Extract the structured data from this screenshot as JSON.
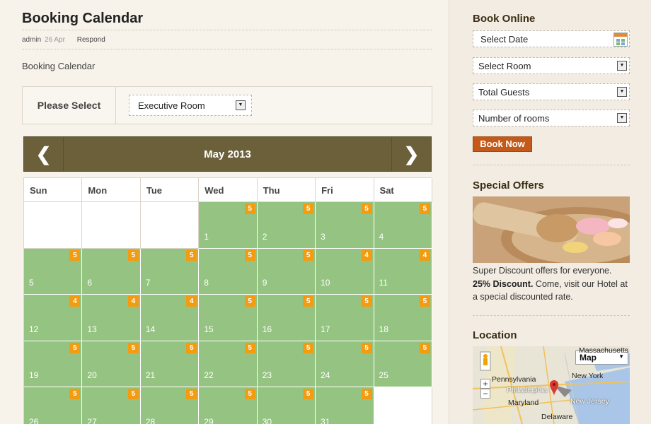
{
  "post": {
    "title": "Booking Calendar",
    "author": "admin",
    "date": "26 Apr",
    "respond": "Respond",
    "subtitle": "Booking Calendar"
  },
  "selector": {
    "label": "Please Select",
    "room_value": "Executive Room"
  },
  "calendar": {
    "prev_label": "❮",
    "next_label": "❯",
    "month": "May 2013",
    "weekdays": [
      "Sun",
      "Mon",
      "Tue",
      "Wed",
      "Thu",
      "Fri",
      "Sat"
    ],
    "leading_empty": 3,
    "days": [
      {
        "day": "1",
        "avail": "5"
      },
      {
        "day": "2",
        "avail": "5"
      },
      {
        "day": "3",
        "avail": "5"
      },
      {
        "day": "4",
        "avail": "5"
      },
      {
        "day": "5",
        "avail": "5"
      },
      {
        "day": "6",
        "avail": "5"
      },
      {
        "day": "7",
        "avail": "5"
      },
      {
        "day": "8",
        "avail": "5"
      },
      {
        "day": "9",
        "avail": "5"
      },
      {
        "day": "10",
        "avail": "4"
      },
      {
        "day": "11",
        "avail": "4"
      },
      {
        "day": "12",
        "avail": "4"
      },
      {
        "day": "13",
        "avail": "4"
      },
      {
        "day": "14",
        "avail": "4"
      },
      {
        "day": "15",
        "avail": "5"
      },
      {
        "day": "16",
        "avail": "5"
      },
      {
        "day": "17",
        "avail": "5"
      },
      {
        "day": "18",
        "avail": "5"
      },
      {
        "day": "19",
        "avail": "5"
      },
      {
        "day": "20",
        "avail": "5"
      },
      {
        "day": "21",
        "avail": "5"
      },
      {
        "day": "22",
        "avail": "5"
      },
      {
        "day": "23",
        "avail": "5"
      },
      {
        "day": "24",
        "avail": "5"
      },
      {
        "day": "25",
        "avail": "5"
      },
      {
        "day": "26",
        "avail": "5"
      },
      {
        "day": "27",
        "avail": "5"
      },
      {
        "day": "28",
        "avail": "5"
      },
      {
        "day": "29",
        "avail": "5"
      },
      {
        "day": "30",
        "avail": "5"
      },
      {
        "day": "31",
        "avail": "5"
      }
    ],
    "colors": {
      "available": "#95c482",
      "badge": "#f39c12",
      "header": "#6b603a"
    }
  },
  "sidebar": {
    "book_online": {
      "heading": "Book Online",
      "date_field": "Select Date",
      "room_field": "Select Room",
      "guests_field": "Total Guests",
      "rooms_field": "Number of rooms",
      "button": "Book Now"
    },
    "offers": {
      "heading": "Special Offers",
      "line1": "Super Discount offers for everyone.",
      "bold": "25% Discount.",
      "line2": " Come, visit our Hotel at a special discounted rate."
    },
    "location": {
      "heading": "Location",
      "map_type": "Map",
      "labels": {
        "massachusetts": "Massachusetts",
        "new_york": "New York",
        "pennsylvania": "Pennsylvania",
        "philadelphia": "Philadelphia",
        "maryland": "Maryland",
        "new_jersey": "New Jersey",
        "delaware": "Delaware"
      }
    }
  }
}
